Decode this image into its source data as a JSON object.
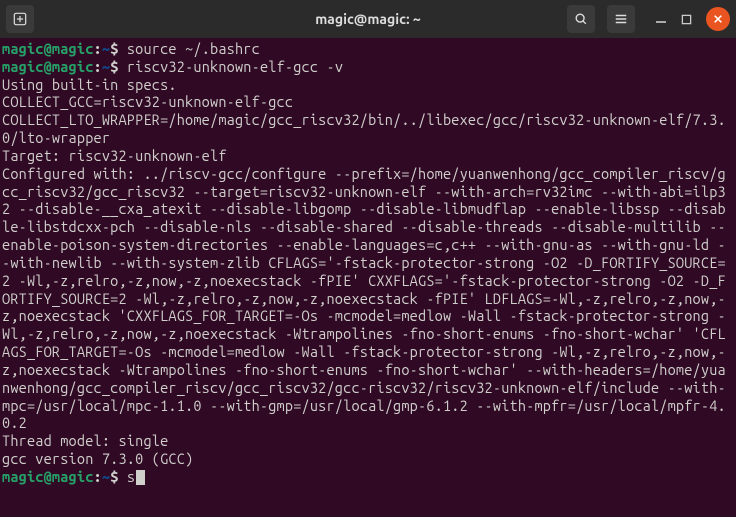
{
  "titlebar": {
    "title": "magic@magic: ~"
  },
  "prompt": {
    "user_host": "magic@magic",
    "colon": ":",
    "path": "~",
    "dollar": "$ "
  },
  "commands": {
    "cmd1": "source ~/.bashrc",
    "cmd2": "riscv32-unknown-elf-gcc -v",
    "cmd3": "s"
  },
  "output": {
    "line1": "Using built-in specs.",
    "line2": "COLLECT_GCC=riscv32-unknown-elf-gcc",
    "line3": "COLLECT_LTO_WRAPPER=/home/magic/gcc_riscv32/bin/../libexec/gcc/riscv32-unknown-elf/7.3.0/lto-wrapper",
    "line4": "Target: riscv32-unknown-elf",
    "line5": "Configured with: ../riscv-gcc/configure --prefix=/home/yuanwenhong/gcc_compiler_riscv/gcc_riscv32/gcc_riscv32 --target=riscv32-unknown-elf --with-arch=rv32imc --with-abi=ilp32 --disable-__cxa_atexit --disable-libgomp --disable-libmudflap --enable-libssp --disable-libstdcxx-pch --disable-nls --disable-shared --disable-threads --disable-multilib --enable-poison-system-directories --enable-languages=c,c++ --with-gnu-as --with-gnu-ld --with-newlib --with-system-zlib CFLAGS='-fstack-protector-strong -O2 -D_FORTIFY_SOURCE=2 -Wl,-z,relro,-z,now,-z,noexecstack -fPIE' CXXFLAGS='-fstack-protector-strong -O2 -D_FORTIFY_SOURCE=2 -Wl,-z,relro,-z,now,-z,noexecstack -fPIE' LDFLAGS=-Wl,-z,relro,-z,now,-z,noexecstack 'CXXFLAGS_FOR_TARGET=-Os -mcmodel=medlow -Wall -fstack-protector-strong -Wl,-z,relro,-z,now,-z,noexecstack -Wtrampolines -fno-short-enums -fno-short-wchar' 'CFLAGS_FOR_TARGET=-Os -mcmodel=medlow -Wall -fstack-protector-strong -Wl,-z,relro,-z,now,-z,noexecstack -Wtrampolines -fno-short-enums -fno-short-wchar' --with-headers=/home/yuanwenhong/gcc_compiler_riscv/gcc_riscv32/gcc-riscv32/riscv32-unknown-elf/include --with-mpc=/usr/local/mpc-1.1.0 --with-gmp=/usr/local/gmp-6.1.2 --with-mpfr=/usr/local/mpfr-4.0.2",
    "line6": "Thread model: single",
    "line7": "gcc version 7.3.0 (GCC)"
  }
}
